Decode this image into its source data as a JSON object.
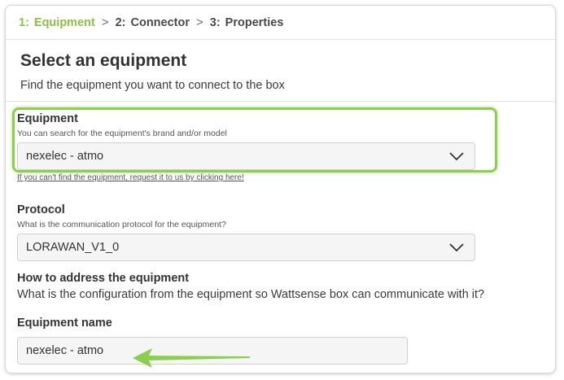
{
  "stepper": {
    "steps": [
      {
        "num": "1:",
        "label": "Equipment"
      },
      {
        "num": "2:",
        "label": "Connector"
      },
      {
        "num": "3:",
        "label": "Properties"
      }
    ],
    "separator": ">",
    "active_color": "#86c441"
  },
  "header": {
    "title": "Select an equipment",
    "subtitle": "Find the equipment you want to connect to the box"
  },
  "equipment": {
    "label": "Equipment",
    "help": "You can search for the equipment's brand and/or model",
    "value": "nexelec - atmo",
    "request_link": "If you can't find the equipment, request it to us by clicking here!"
  },
  "protocol": {
    "label": "Protocol",
    "help": "What is the communication protocol for the equipment?",
    "value": "LORAWAN_V1_0"
  },
  "addressing": {
    "label": "How to address the equipment",
    "description": "What is the configuration from the equipment so Wattsense box can communicate with it?"
  },
  "equipment_name": {
    "label": "Equipment name",
    "value": "nexelec - atmo"
  },
  "annotations": {
    "highlight_color": "#8ad04a",
    "arrow_color": "#8ad04a",
    "icons": [
      "chevron-down-icon",
      "arrow-annotation-icon"
    ]
  }
}
